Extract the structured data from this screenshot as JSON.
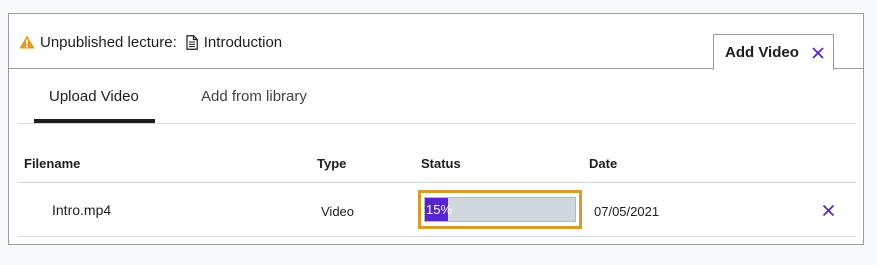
{
  "lecture": {
    "status_label": "Unpublished lecture:",
    "title": "Introduction",
    "warning_icon": "warning-icon",
    "document_icon": "document-icon"
  },
  "add_video_tab": {
    "label": "Add Video",
    "close_icon": "close-icon"
  },
  "tabs": [
    {
      "label": "Upload Video",
      "active": true
    },
    {
      "label": "Add from library",
      "active": false
    }
  ],
  "table": {
    "headers": [
      "Filename",
      "Type",
      "Status",
      "Date"
    ],
    "rows": [
      {
        "filename": "Intro.mp4",
        "type": "Video",
        "status_text": "15%",
        "progress": 0.15,
        "date": "07/05/2021",
        "remove_icon": "close-icon"
      }
    ]
  },
  "colors": {
    "accent": "#5624d0",
    "highlight": "#d89b2b",
    "warning": "#e59819",
    "text": "#1c1d1f"
  }
}
